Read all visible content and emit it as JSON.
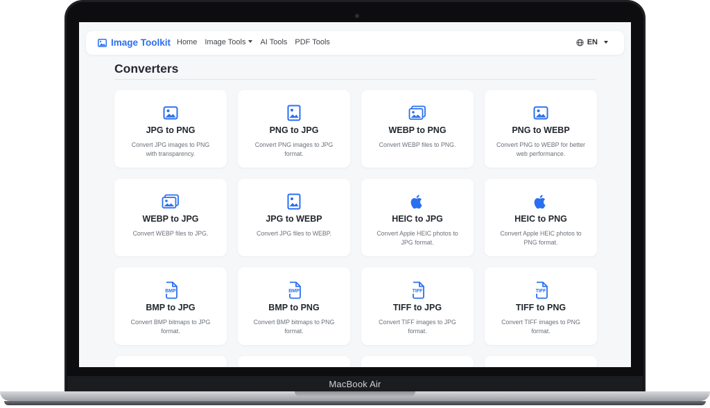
{
  "device_label": "MacBook Air",
  "navbar": {
    "brand": "Image Toolkit",
    "links": [
      "Home",
      "Image Tools",
      "AI Tools",
      "PDF Tools"
    ],
    "language": "EN"
  },
  "section": {
    "title": "Converters"
  },
  "cards": [
    {
      "icon": "image-icon",
      "title": "JPG to PNG",
      "desc": "Convert JPG images to PNG with transparency."
    },
    {
      "icon": "image-file-icon",
      "title": "PNG to JPG",
      "desc": "Convert PNG images to JPG format."
    },
    {
      "icon": "images-icon",
      "title": "WEBP to PNG",
      "desc": "Convert WEBP files to PNG."
    },
    {
      "icon": "image-icon",
      "title": "PNG to WEBP",
      "desc": "Convert PNG to WEBP for better web performance."
    },
    {
      "icon": "images-icon",
      "title": "WEBP to JPG",
      "desc": "Convert WEBP files to JPG."
    },
    {
      "icon": "image-file-icon",
      "title": "JPG to WEBP",
      "desc": "Convert JPG files to WEBP."
    },
    {
      "icon": "apple-icon",
      "title": "HEIC to JPG",
      "desc": "Convert Apple HEIC photos to JPG format."
    },
    {
      "icon": "apple-icon",
      "title": "HEIC to PNG",
      "desc": "Convert Apple HEIC photos to PNG format."
    },
    {
      "icon": "bmp-file-icon",
      "title": "BMP to JPG",
      "desc": "Convert BMP bitmaps to JPG format.",
      "badge": "BMP"
    },
    {
      "icon": "bmp-file-icon",
      "title": "BMP to PNG",
      "desc": "Convert BMP bitmaps to PNG format.",
      "badge": "BMP"
    },
    {
      "icon": "tiff-file-icon",
      "title": "TIFF to JPG",
      "desc": "Convert TIFF images to JPG format.",
      "badge": "TIFF"
    },
    {
      "icon": "tiff-file-icon",
      "title": "TIFF to PNG",
      "desc": "Convert TIFF images to PNG format.",
      "badge": "TIFF"
    }
  ],
  "colors": {
    "accent": "#2a6ff0",
    "background": "#f6f7f9",
    "card": "#ffffff"
  }
}
